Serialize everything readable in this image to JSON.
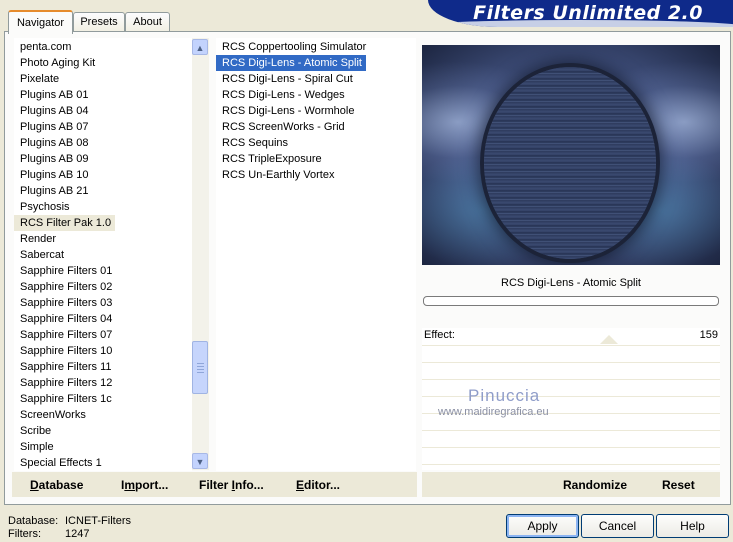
{
  "tabs": [
    {
      "label": "Navigator",
      "active": true
    },
    {
      "label": "Presets",
      "active": false
    },
    {
      "label": "About",
      "active": false
    }
  ],
  "banner": {
    "title": "Filters Unlimited 2.0"
  },
  "categories": {
    "items": [
      "penta.com",
      "Photo Aging Kit",
      "Pixelate",
      "Plugins AB 01",
      "Plugins AB 04",
      "Plugins AB 07",
      "Plugins AB 08",
      "Plugins AB 09",
      "Plugins AB 10",
      "Plugins AB 21",
      "Psychosis",
      "RCS Filter Pak 1.0",
      "Render",
      "Sabercat",
      "Sapphire Filters 01",
      "Sapphire Filters 02",
      "Sapphire Filters 03",
      "Sapphire Filters 04",
      "Sapphire Filters 07",
      "Sapphire Filters 10",
      "Sapphire Filters 11",
      "Sapphire Filters 12",
      "Sapphire Filters 1c",
      "ScreenWorks",
      "Scribe",
      "Simple",
      "Special Effects 1"
    ],
    "selected": "RCS Filter Pak 1.0"
  },
  "filters": {
    "items": [
      "RCS Coppertooling Simulator",
      "RCS Digi-Lens - Atomic Split",
      "RCS Digi-Lens - Spiral Cut",
      "RCS Digi-Lens - Wedges",
      "RCS Digi-Lens - Wormhole",
      "RCS ScreenWorks - Grid",
      "RCS Sequins",
      "RCS TripleExposure",
      "RCS Un-Earthly Vortex"
    ],
    "selected": "RCS Digi-Lens - Atomic Split"
  },
  "preview": {
    "filter_name": "RCS Digi-Lens - Atomic Split",
    "progress": 0
  },
  "parameters": [
    {
      "label": "Effect:",
      "value": "159"
    }
  ],
  "watermark": {
    "line1": "Pinuccia",
    "line2": "www.maidiregrafica.eu"
  },
  "left_buttons": {
    "database": {
      "underline": "D",
      "rest": "atabase"
    },
    "import": {
      "pre": "I",
      "underline": "m",
      "rest": "port..."
    },
    "filter_info": {
      "pre": "Filter ",
      "underline": "I",
      "rest": "nfo..."
    },
    "editor": {
      "underline": "E",
      "rest": "ditor..."
    }
  },
  "right_buttons": {
    "randomize": "Randomize",
    "reset": "Reset"
  },
  "status": {
    "database_label": "Database:",
    "database_value": "ICNET-Filters",
    "filters_label": "Filters:",
    "filters_value": "1247"
  },
  "dialog_buttons": {
    "apply": "Apply",
    "cancel": "Cancel",
    "help": "Help"
  },
  "colors": {
    "selection_blue": "#316ac5",
    "banner_blue": "#0f2a8a",
    "window_bg": "#ece9d8"
  },
  "icons": {
    "scroll_up": "up-arrow-icon",
    "scroll_down": "down-arrow-icon",
    "thumb_grip": "grip-icon"
  }
}
